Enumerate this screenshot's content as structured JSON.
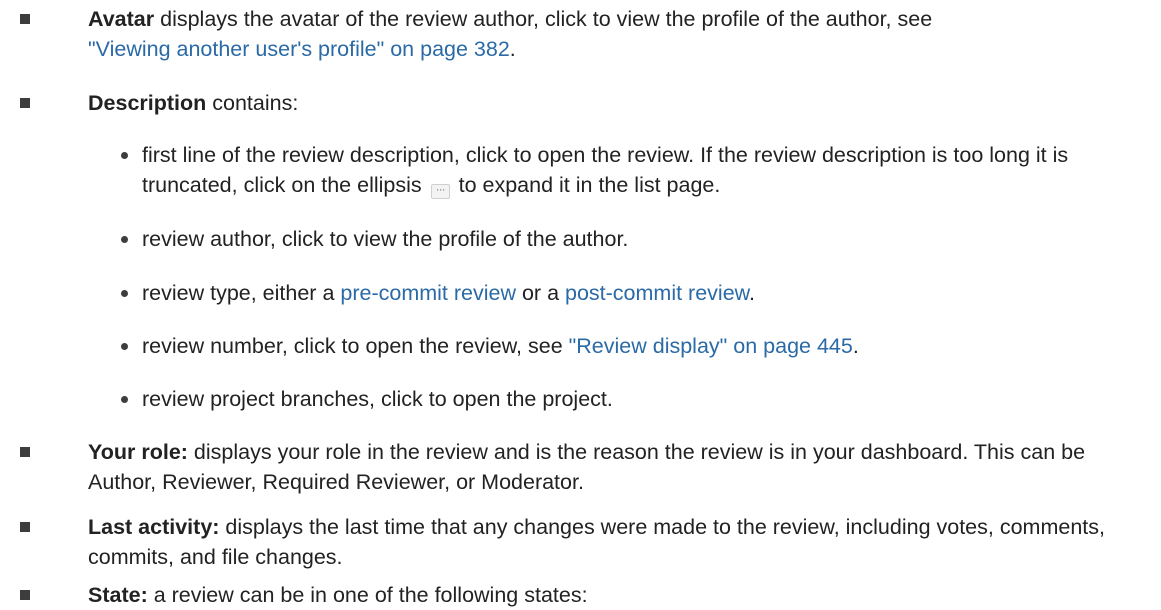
{
  "items": [
    {
      "term": "Avatar",
      "text": " displays the avatar of the review author, click to view the profile of the author, see ",
      "link": "\"Viewing another user's profile\" on page 382",
      "tail": "."
    },
    {
      "term": "Description",
      "text": " contains:"
    },
    {
      "term": "Your role:",
      "text": " displays your role in the review and is the reason the review is in your dashboard. This can be Author, Reviewer, Required Reviewer, or Moderator."
    },
    {
      "term": "Last activity:",
      "text": "  displays the last time that any changes were made to the review, including votes, comments, commits, and file changes."
    },
    {
      "term": "State:",
      "text": " a review can be in one of the following states:"
    }
  ],
  "description_sub": [
    {
      "text_a": "first line of the review description, click to open the review. If the review description is too long it is truncated, click on the ellipsis ",
      "ellipsis_icon": "ellipsis-icon",
      "text_b": " to expand it in the list page."
    },
    {
      "text": "review author, click to view the profile of the author."
    },
    {
      "text": "review type, either a ",
      "link1": "pre-commit review",
      "mid": " or a ",
      "link2": "post-commit review",
      "tail": "."
    },
    {
      "text": "review number, click to open the review, see ",
      "link": "\"Review display\" on page 445",
      "tail": "."
    },
    {
      "text": "review project branches, click to open the project."
    }
  ]
}
